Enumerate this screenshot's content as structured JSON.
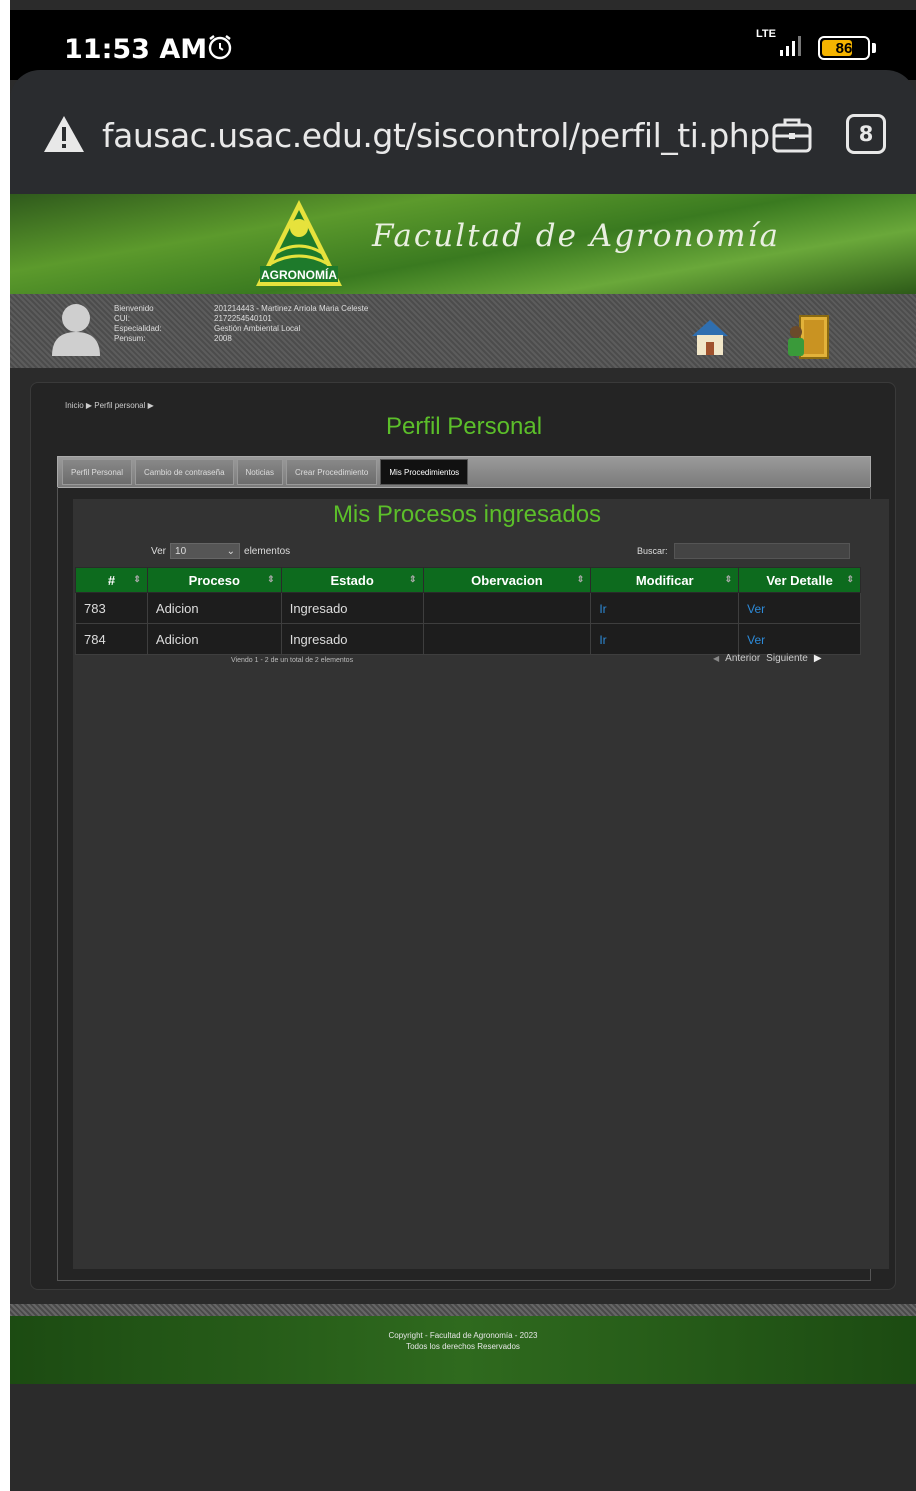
{
  "status": {
    "time": "11:53 AM",
    "network": "LTE",
    "battery": "86"
  },
  "browser": {
    "url": "fausac.usac.edu.gt/siscontrol/perfil_ti.php",
    "tab_count": "8"
  },
  "banner": {
    "logo_text": "AGRONOMÍA",
    "title": "Facultad de Agronomía"
  },
  "user": {
    "rows": [
      {
        "label": "Bienvenido",
        "value": "201214443 - Martinez Arriola Maria Celeste"
      },
      {
        "label": "CUI:",
        "value": "2172254540101"
      },
      {
        "label": "Especialidad:",
        "value": "Gestión Ambiental Local"
      },
      {
        "label": "Pensum:",
        "value": "2008"
      }
    ]
  },
  "main": {
    "breadcrumb": "Inicio ▶ Perfil personal ▶",
    "title": "Perfil Personal",
    "tabs": [
      {
        "label": "Perfil Personal"
      },
      {
        "label": "Cambio de contraseña"
      },
      {
        "label": "Noticias"
      },
      {
        "label": "Crear Procedimiento"
      },
      {
        "label": "Mis Procedimientos"
      }
    ]
  },
  "panel": {
    "title": "Mis Procesos ingresados",
    "show_prefix": "Ver",
    "show_value": "10",
    "show_suffix": "elementos",
    "search_label": "Buscar:",
    "columns": [
      "#",
      "Proceso",
      "Estado",
      "Obervacion",
      "Modificar",
      "Ver Detalle"
    ],
    "rows": [
      {
        "id": "783",
        "proceso": "Adicion",
        "estado": "Ingresado",
        "observacion": "",
        "modificar": "Ir",
        "detalle": "Ver"
      },
      {
        "id": "784",
        "proceso": "Adicion",
        "estado": "Ingresado",
        "observacion": "",
        "modificar": "Ir",
        "detalle": "Ver"
      }
    ],
    "info": "Viendo 1 - 2 de un total de 2 elementos",
    "prev": "Anterior",
    "next": "Siguiente"
  },
  "footer": {
    "line1": "Copyright - Facultad de Agronomía - 2023",
    "line2": "Todos los derechos Reservados"
  },
  "colors": {
    "accent_green": "#5cbf2a",
    "header_green": "#0d6b1e",
    "link_blue": "#2d8ad8"
  }
}
